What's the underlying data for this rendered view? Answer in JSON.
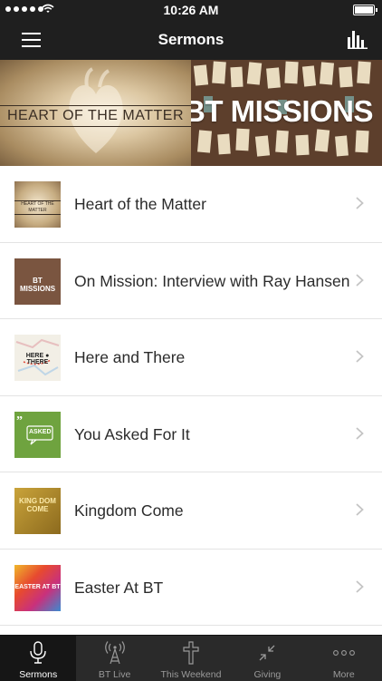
{
  "status_bar": {
    "time": "10:26 AM"
  },
  "header": {
    "title": "Sermons"
  },
  "banner": {
    "left_text": "HEART OF THE MATTER",
    "right_text": "BT MISSIONS"
  },
  "sermons": [
    {
      "title": "Heart of the Matter",
      "thumb_text": "HEART OF THE MATTER"
    },
    {
      "title": "On Mission: Interview with Ray Hansen",
      "thumb_text": "BT MISSIONS"
    },
    {
      "title": "Here and There",
      "thumb_text": "HERE ● THERE"
    },
    {
      "title": "You Asked For It",
      "thumb_text": "ASKED"
    },
    {
      "title": "Kingdom Come",
      "thumb_text": "KING DOM COME"
    },
    {
      "title": "Easter At BT",
      "thumb_text": "EASTER AT BT"
    }
  ],
  "tabs": [
    {
      "label": "Sermons",
      "icon": "microphone-icon",
      "active": true
    },
    {
      "label": "BT Live",
      "icon": "broadcast-tower-icon",
      "active": false
    },
    {
      "label": "This Weekend",
      "icon": "cross-icon",
      "active": false
    },
    {
      "label": "Giving",
      "icon": "collapse-arrows-icon",
      "active": false
    },
    {
      "label": "More",
      "icon": "more-dots-icon",
      "active": false
    }
  ],
  "colors": {
    "bar_bg": "#1f1f1f",
    "tab_bg": "#2a2a2a",
    "active_tab_bg": "#161616"
  }
}
